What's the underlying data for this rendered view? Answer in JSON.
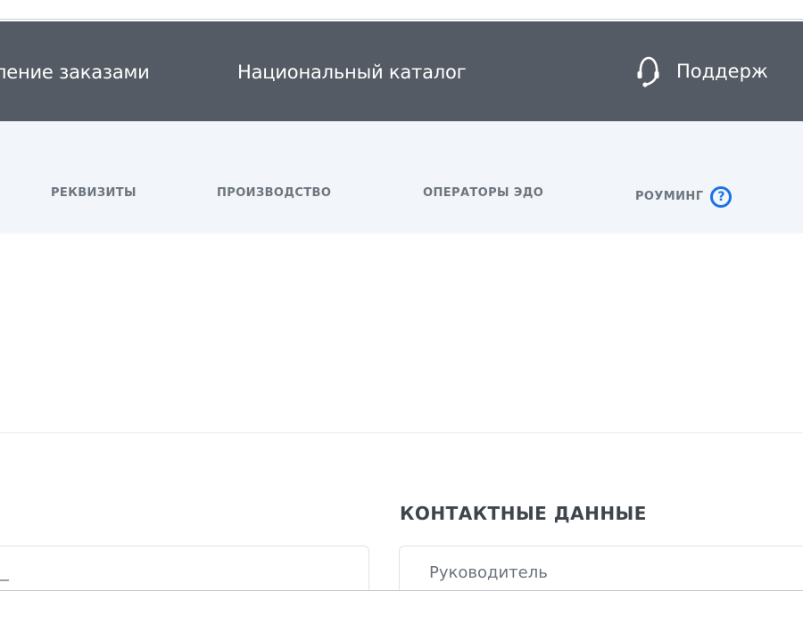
{
  "top_nav": {
    "orders_label": "ление заказами",
    "catalog_label": "Национальный каталог",
    "support_label": "Поддерж"
  },
  "sub_nav": {
    "tabs": [
      {
        "label": "РЕКВИЗИТЫ"
      },
      {
        "label": "ПРОИЗВОДСТВО"
      },
      {
        "label": "ОПЕРАТОРЫ ЭДО"
      },
      {
        "label": "РОУМИНГ"
      }
    ],
    "help_glyph": "?"
  },
  "contacts": {
    "section_title": "КОНТАКТНЫЕ ДАННЫЕ",
    "head_label": "Руководитель"
  },
  "colors": {
    "top_nav_bg": "#545b64",
    "sub_nav_bg": "#f2f5f9",
    "accent": "#1a73e8"
  },
  "icons": {
    "support": "headset-icon",
    "help": "question-circle-icon"
  }
}
